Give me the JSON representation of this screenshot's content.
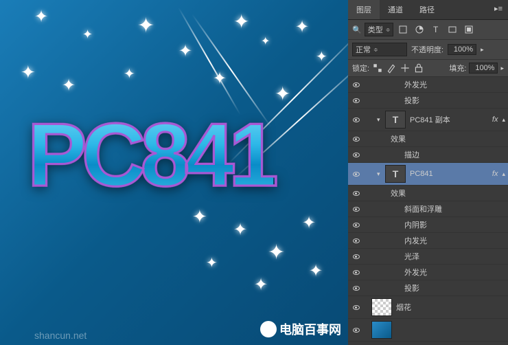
{
  "canvas": {
    "text": "PC841",
    "watermark": "电脑百事网",
    "watermark_url": "shancun.net"
  },
  "panel": {
    "tabs": [
      "图层",
      "通道",
      "路径"
    ],
    "active_tab": 0,
    "filter_dropdown": "类型",
    "blend_mode": "正常",
    "opacity_label": "不透明度:",
    "opacity_value": "100%",
    "lock_label": "锁定:",
    "fill_label": "填充:",
    "fill_value": "100%",
    "fx_label": "fx",
    "layers": [
      {
        "type": "effect-item",
        "indent": 3,
        "name": "外发光"
      },
      {
        "type": "effect-item",
        "indent": 3,
        "name": "投影"
      },
      {
        "type": "text-layer",
        "indent": 1,
        "name": "PC841 副本",
        "fx": true
      },
      {
        "type": "effect-header",
        "indent": 2,
        "name": "效果"
      },
      {
        "type": "effect-item",
        "indent": 3,
        "name": "描边"
      },
      {
        "type": "text-layer",
        "indent": 1,
        "name": "PC841",
        "fx": true,
        "selected": true
      },
      {
        "type": "effect-header",
        "indent": 2,
        "name": "效果"
      },
      {
        "type": "effect-item",
        "indent": 3,
        "name": "斜面和浮雕"
      },
      {
        "type": "effect-item",
        "indent": 3,
        "name": "内阴影"
      },
      {
        "type": "effect-item",
        "indent": 3,
        "name": "内发光"
      },
      {
        "type": "effect-item",
        "indent": 3,
        "name": "光泽"
      },
      {
        "type": "effect-item",
        "indent": 3,
        "name": "外发光"
      },
      {
        "type": "effect-item",
        "indent": 3,
        "name": "投影"
      },
      {
        "type": "image-layer",
        "indent": 0,
        "name": "烟花",
        "thumb": "checker"
      },
      {
        "type": "image-layer",
        "indent": 0,
        "name": "",
        "thumb": "blue"
      }
    ]
  }
}
